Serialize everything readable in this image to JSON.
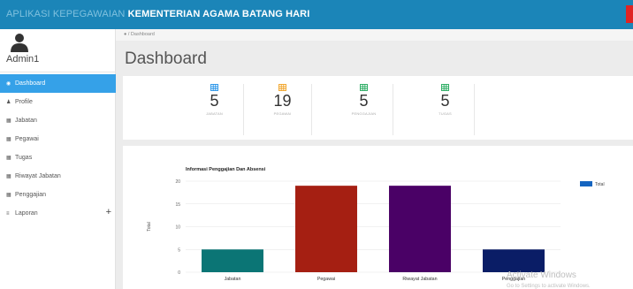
{
  "header": {
    "app_title": "APLIKASI KEPEGAWAIAN",
    "org_title": "KEMENTERIAN AGAMA BATANG HARI",
    "accent_color": "#1b85b8"
  },
  "user": {
    "name": "Admin1"
  },
  "breadcrumb": {
    "icon": "home-icon",
    "separator": "/",
    "current": "Dashboard"
  },
  "page": {
    "title": "Dashboard"
  },
  "sidebar": {
    "items": [
      {
        "label": "Dashboard",
        "icon": "dashboard-icon",
        "active": true
      },
      {
        "label": "Profile",
        "icon": "user-icon"
      },
      {
        "label": "Jabatan",
        "icon": "table-icon"
      },
      {
        "label": "Pegawai",
        "icon": "table-icon"
      },
      {
        "label": "Tugas",
        "icon": "table-icon"
      },
      {
        "label": "Riwayat Jabatan",
        "icon": "table-icon"
      },
      {
        "label": "Penggajian",
        "icon": "table-icon"
      },
      {
        "label": "Laporan",
        "icon": "list-icon",
        "expand": "+"
      }
    ]
  },
  "stats": [
    {
      "value": "5",
      "label": "JABATAN",
      "color": "#1e90e8",
      "icon": "table-icon"
    },
    {
      "value": "19",
      "label": "PEGAWAI",
      "color": "#f0a020",
      "icon": "table-icon"
    },
    {
      "value": "5",
      "label": "PENGGAJIAN",
      "color": "#1fa85a",
      "icon": "table-icon"
    },
    {
      "value": "5",
      "label": "TUGAS",
      "color": "#1fa85a",
      "icon": "table-icon"
    }
  ],
  "chart_data": {
    "type": "bar",
    "title": "Informasi Penggajian Dan Absensi",
    "categories": [
      "Jabatan",
      "Pegawai",
      "Riwayat Jabatan",
      "Penggajian"
    ],
    "series": [
      {
        "name": "Total",
        "values": [
          5,
          19,
          19,
          5
        ],
        "color": "#1565c0"
      }
    ],
    "bar_colors": [
      "#0b7575",
      "#a51f12",
      "#4a0166",
      "#0a1d66"
    ],
    "ylabel": "Total",
    "xlabel": "",
    "ylim": [
      0,
      20
    ],
    "yticks": [
      0,
      5,
      10,
      15,
      20
    ],
    "grid": true,
    "legend_position": "top-right"
  },
  "watermark": {
    "line1": "Activate Windows",
    "line2": "Go to Settings to activate Windows."
  }
}
